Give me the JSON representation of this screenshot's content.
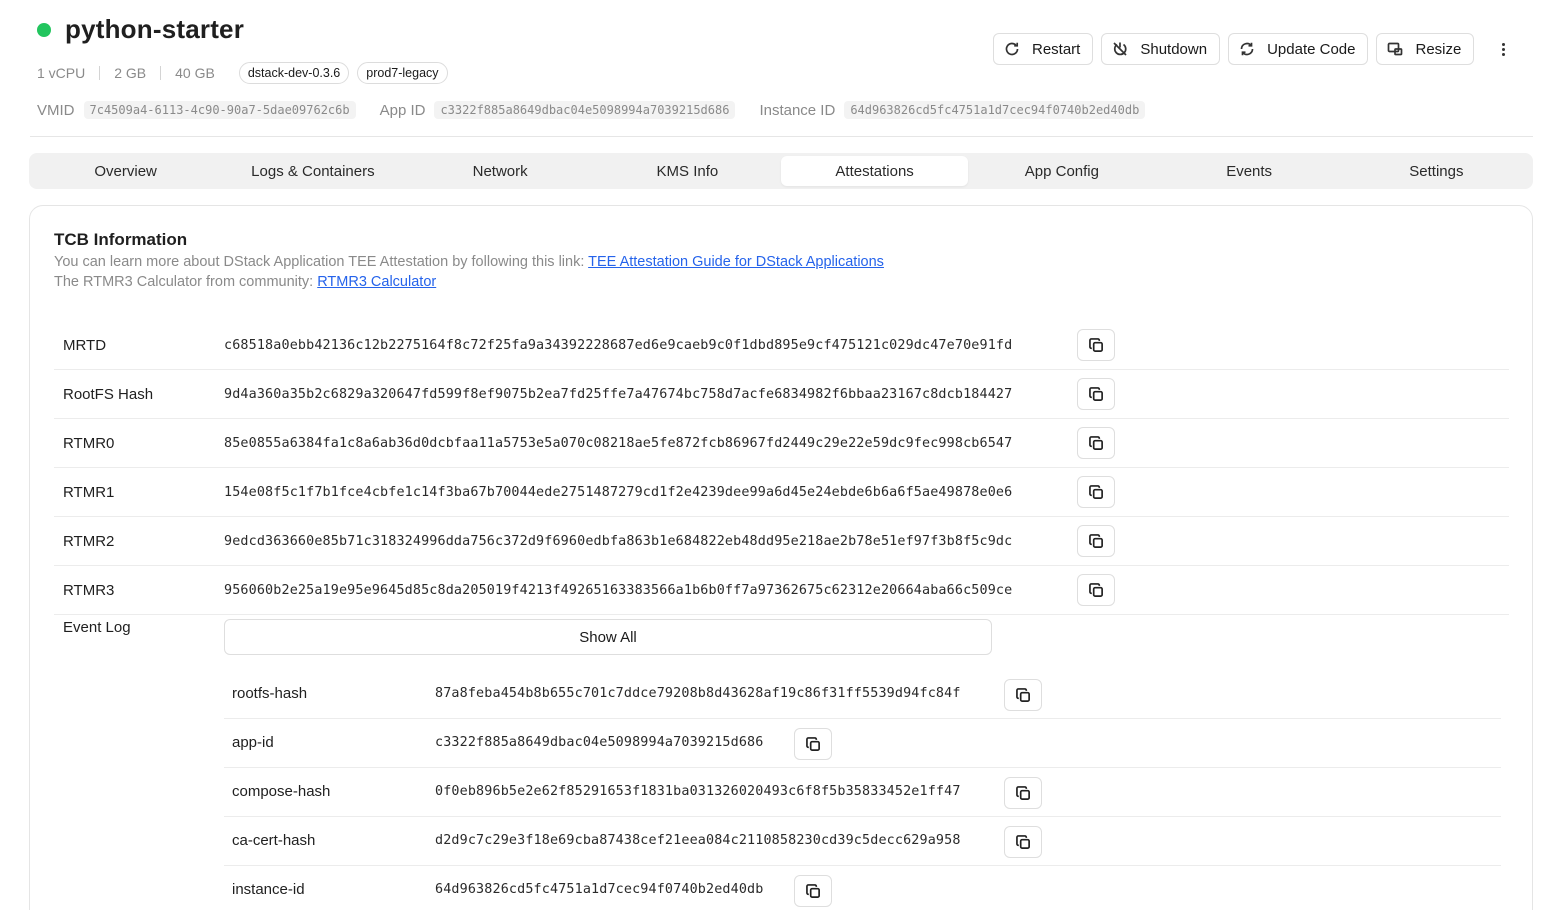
{
  "app": {
    "name": "python-starter",
    "status_color": "#22c55e",
    "specs": [
      "1 vCPU",
      "2 GB",
      "40 GB"
    ],
    "tags": [
      "dstack-dev-0.3.6",
      "prod7-legacy"
    ],
    "vmid_label": "VMID",
    "vmid": "7c4509a4-6113-4c90-90a7-5dae09762c6b",
    "app_id_label": "App ID",
    "app_id": "c3322f885a8649dbac04e5098994a7039215d686",
    "instance_id_label": "Instance ID",
    "instance_id": "64d963826cd5fc4751a1d7cec94f0740b2ed40db"
  },
  "actions": {
    "restart": "Restart",
    "shutdown": "Shutdown",
    "update_code": "Update Code",
    "resize": "Resize"
  },
  "tabs": [
    {
      "label": "Overview"
    },
    {
      "label": "Logs & Containers"
    },
    {
      "label": "Network"
    },
    {
      "label": "KMS Info"
    },
    {
      "label": "Attestations",
      "active": true
    },
    {
      "label": "App Config"
    },
    {
      "label": "Events"
    },
    {
      "label": "Settings"
    }
  ],
  "tcb": {
    "title": "TCB Information",
    "intro_text": "You can learn more about DStack Application TEE Attestation by following this link: ",
    "guide_link": "TEE Attestation Guide for DStack Applications",
    "calc_text": "The RTMR3 Calculator from community: ",
    "calc_link": "RTMR3 Calculator",
    "rows": [
      {
        "label": "MRTD",
        "value": "c68518a0ebb42136c12b2275164f8c72f25fa9a34392228687ed6e9caeb9c0f1dbd895e9cf475121c029dc47e70e91fd"
      },
      {
        "label": "RootFS Hash",
        "value": "9d4a360a35b2c6829a320647fd599f8ef9075b2ea7fd25ffe7a47674bc758d7acfe6834982f6bbaa23167c8dcb184427"
      },
      {
        "label": "RTMR0",
        "value": "85e0855a6384fa1c8a6ab36d0dcbfaa11a5753e5a070c08218ae5fe872fcb86967fd2449c29e22e59dc9fec998cb6547"
      },
      {
        "label": "RTMR1",
        "value": "154e08f5c1f7b1fce4cbfe1c14f3ba67b70044ede2751487279cd1f2e4239dee99a6d45e24ebde6b6a6f5ae49878e0e6"
      },
      {
        "label": "RTMR2",
        "value": "9edcd363660e85b71c318324996dda756c372d9f6960edbfa863b1e684822eb48dd95e218ae2b78e51ef97f3b8f5c9dc"
      },
      {
        "label": "RTMR3",
        "value": "956060b2e25a19e95e9645d85c8da205019f4213f49265163383566a1b6b0ff7a97362675c62312e20664aba66c509ce"
      }
    ],
    "event_log_label": "Event Log",
    "show_all_label": "Show All",
    "events": [
      {
        "key": "rootfs-hash",
        "value": "87a8feba454b8b655c701c7ddce79208b8d43628af19c86f31ff5539d94fc84f"
      },
      {
        "key": "app-id",
        "value": "c3322f885a8649dbac04e5098994a7039215d686"
      },
      {
        "key": "compose-hash",
        "value": "0f0eb896b5e2e62f85291653f1831ba031326020493c6f8f5b35833452e1ff47"
      },
      {
        "key": "ca-cert-hash",
        "value": "d2d9c7c29e3f18e69cba87438cef21eea084c2110858230cd39c5decc629a958"
      },
      {
        "key": "instance-id",
        "value": "64d963826cd5fc4751a1d7cec94f0740b2ed40db"
      }
    ]
  }
}
